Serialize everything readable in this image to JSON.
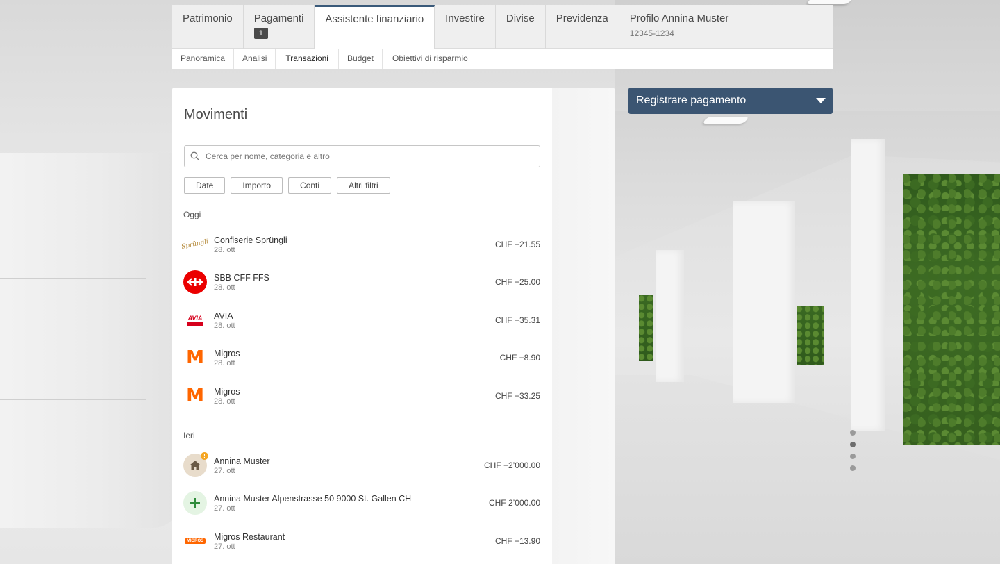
{
  "nav": {
    "tabs": [
      {
        "label": "Patrimonio"
      },
      {
        "label": "Pagamenti",
        "badge": "1"
      },
      {
        "label": "Assistente finanziario"
      },
      {
        "label": "Investire"
      },
      {
        "label": "Divise"
      },
      {
        "label": "Previdenza"
      },
      {
        "label": "Profilo Annina Muster",
        "sub": "12345-1234"
      }
    ],
    "active_tab": "Assistente finanziario",
    "subtabs": [
      {
        "label": "Panoramica"
      },
      {
        "label": "Analisi"
      },
      {
        "label": "Transazioni"
      },
      {
        "label": "Budget"
      },
      {
        "label": "Obiettivi di risparmio"
      }
    ],
    "active_subtab": "Transazioni"
  },
  "panel": {
    "title": "Movimenti",
    "search_placeholder": "Cerca per nome, categoria e altro",
    "filters": [
      "Date",
      "Importo",
      "Conti",
      "Altri filtri"
    ]
  },
  "groups": [
    {
      "label": "Oggi",
      "transactions": [
        {
          "name": "Confiserie Sprüngli",
          "date": "28. ott",
          "amount": "CHF −21.55",
          "logo": "spruengli-logo"
        },
        {
          "name": "SBB CFF FFS",
          "date": "28. ott",
          "amount": "CHF −25.00",
          "logo": "sbb-logo"
        },
        {
          "name": "AVIA",
          "date": "28. ott",
          "amount": "CHF −35.31",
          "logo": "avia-logo"
        },
        {
          "name": "Migros",
          "date": "28. ott",
          "amount": "CHF −8.90",
          "logo": "migros-logo"
        },
        {
          "name": "Migros",
          "date": "28. ott",
          "amount": "CHF −33.25",
          "logo": "migros-logo"
        }
      ]
    },
    {
      "label": "Ieri",
      "transactions": [
        {
          "name": "Annina Muster",
          "date": "27. ott",
          "amount": "CHF −2’000.00",
          "logo": "home-icon"
        },
        {
          "name": "Annina Muster Alpenstrasse 50 9000 St. Gallen CH",
          "date": "27. ott",
          "amount": "CHF 2’000.00",
          "logo": "plus-icon"
        },
        {
          "name": "Migros Restaurant",
          "date": "27. ott",
          "amount": "CHF −13.90",
          "logo": "migros-restaurant-logo"
        }
      ]
    }
  ],
  "logo_texts": {
    "spruengli": "Sprüngli",
    "avia": "AVIA",
    "migros": "M",
    "migros_restaurant": "MIGROS"
  },
  "actions": {
    "register_payment": "Registrare pagamento"
  },
  "colors": {
    "accent": "#3b5572",
    "sbb_red": "#eb0000",
    "migros_orange": "#ff6600",
    "avia_red": "#d6001c"
  }
}
